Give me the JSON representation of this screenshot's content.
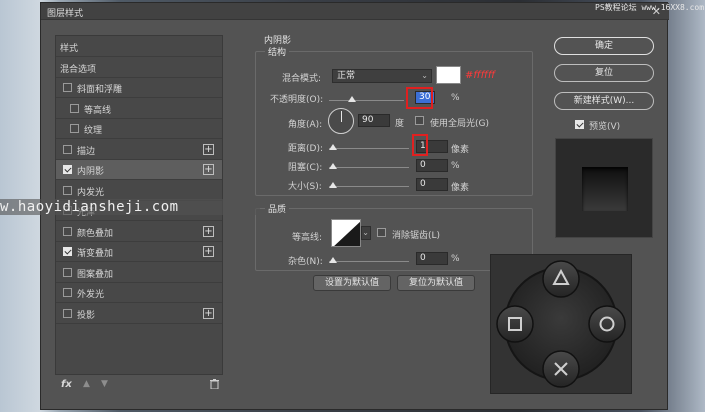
{
  "window": {
    "title": "图层样式",
    "close_glyph": "✕",
    "source_mark": "PS教程论坛 www.16XX8.com"
  },
  "watermark": "w.haoyidiansheji.com",
  "left_panel": {
    "items": [
      {
        "label": "样式",
        "checkbox": false,
        "checked": false,
        "plus": false,
        "indent": 0,
        "selected": false
      },
      {
        "label": "混合选项",
        "checkbox": false,
        "checked": false,
        "plus": false,
        "indent": 0,
        "selected": false
      },
      {
        "label": "斜面和浮雕",
        "checkbox": true,
        "checked": false,
        "plus": false,
        "indent": 0,
        "selected": false
      },
      {
        "label": "等高线",
        "checkbox": true,
        "checked": false,
        "plus": false,
        "indent": 1,
        "selected": false
      },
      {
        "label": "纹理",
        "checkbox": true,
        "checked": false,
        "plus": false,
        "indent": 1,
        "selected": false
      },
      {
        "label": "描边",
        "checkbox": true,
        "checked": false,
        "plus": true,
        "indent": 0,
        "selected": false
      },
      {
        "label": "内阴影",
        "checkbox": true,
        "checked": true,
        "plus": true,
        "indent": 0,
        "selected": true
      },
      {
        "label": "内发光",
        "checkbox": true,
        "checked": false,
        "plus": false,
        "indent": 0,
        "selected": false
      },
      {
        "label": "光泽",
        "checkbox": true,
        "checked": false,
        "plus": false,
        "indent": 0,
        "selected": false
      },
      {
        "label": "颜色叠加",
        "checkbox": true,
        "checked": false,
        "plus": true,
        "indent": 0,
        "selected": false
      },
      {
        "label": "渐变叠加",
        "checkbox": true,
        "checked": true,
        "plus": true,
        "indent": 0,
        "selected": false
      },
      {
        "label": "图案叠加",
        "checkbox": true,
        "checked": false,
        "plus": false,
        "indent": 0,
        "selected": false
      },
      {
        "label": "外发光",
        "checkbox": true,
        "checked": false,
        "plus": false,
        "indent": 0,
        "selected": false
      },
      {
        "label": "投影",
        "checkbox": true,
        "checked": false,
        "plus": true,
        "indent": 0,
        "selected": false
      }
    ],
    "footer": {
      "fx_label": "fx"
    }
  },
  "inner_shadow": {
    "section_title": "内阴影",
    "structure_label": "结构",
    "blend_mode_label": "混合模式:",
    "blend_mode_value": "正常",
    "color_hex_note": "#ffffff",
    "opacity_label": "不透明度(O):",
    "opacity_value": "30",
    "opacity_unit": "%",
    "opacity_level": 0.3,
    "angle_label": "角度(A):",
    "angle_value": "90",
    "angle_unit": "度",
    "global_light_label": "使用全局光(G)",
    "distance_label": "距离(D):",
    "distance_value": "1",
    "distance_unit": "像素",
    "choke_label": "阻塞(C):",
    "choke_value": "0",
    "choke_unit": "%",
    "size_label": "大小(S):",
    "size_value": "0",
    "size_unit": "像素",
    "quality_label": "品质",
    "contour_label": "等高线:",
    "antialias_label": "消除锯齿(L)",
    "noise_label": "杂色(N):",
    "noise_value": "0",
    "noise_unit": "%",
    "make_default_label": "设置为默认值",
    "reset_default_label": "复位为默认值"
  },
  "right_panel": {
    "ok_label": "确定",
    "reset_label": "复位",
    "new_style_label": "新建样式(W)...",
    "preview_label": "预览(V)",
    "preview_checked": true
  },
  "colors": {
    "dialog_bg": "#535353",
    "accent_red": "#e02020",
    "highlight_blue": "#3b6fd6",
    "swatch": "#ffffff"
  }
}
